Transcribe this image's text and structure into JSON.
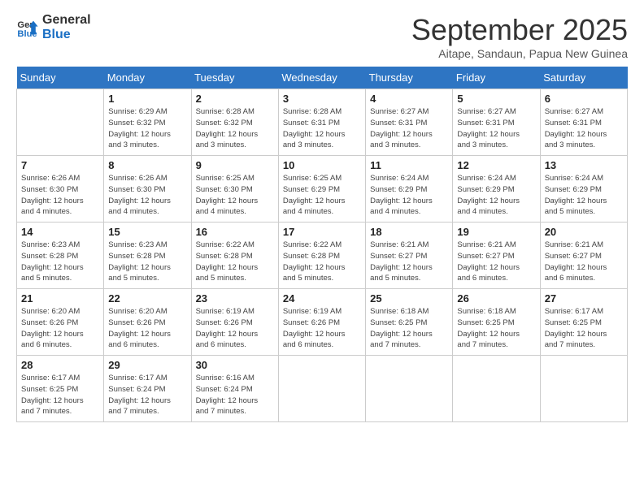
{
  "logo": {
    "line1": "General",
    "line2": "Blue"
  },
  "title": "September 2025",
  "subtitle": "Aitape, Sandaun, Papua New Guinea",
  "days_of_week": [
    "Sunday",
    "Monday",
    "Tuesday",
    "Wednesday",
    "Thursday",
    "Friday",
    "Saturday"
  ],
  "weeks": [
    [
      {
        "day": "",
        "info": ""
      },
      {
        "day": "1",
        "info": "Sunrise: 6:29 AM\nSunset: 6:32 PM\nDaylight: 12 hours\nand 3 minutes."
      },
      {
        "day": "2",
        "info": "Sunrise: 6:28 AM\nSunset: 6:32 PM\nDaylight: 12 hours\nand 3 minutes."
      },
      {
        "day": "3",
        "info": "Sunrise: 6:28 AM\nSunset: 6:31 PM\nDaylight: 12 hours\nand 3 minutes."
      },
      {
        "day": "4",
        "info": "Sunrise: 6:27 AM\nSunset: 6:31 PM\nDaylight: 12 hours\nand 3 minutes."
      },
      {
        "day": "5",
        "info": "Sunrise: 6:27 AM\nSunset: 6:31 PM\nDaylight: 12 hours\nand 3 minutes."
      },
      {
        "day": "6",
        "info": "Sunrise: 6:27 AM\nSunset: 6:31 PM\nDaylight: 12 hours\nand 3 minutes."
      }
    ],
    [
      {
        "day": "7",
        "info": "Sunrise: 6:26 AM\nSunset: 6:30 PM\nDaylight: 12 hours\nand 4 minutes."
      },
      {
        "day": "8",
        "info": "Sunrise: 6:26 AM\nSunset: 6:30 PM\nDaylight: 12 hours\nand 4 minutes."
      },
      {
        "day": "9",
        "info": "Sunrise: 6:25 AM\nSunset: 6:30 PM\nDaylight: 12 hours\nand 4 minutes."
      },
      {
        "day": "10",
        "info": "Sunrise: 6:25 AM\nSunset: 6:29 PM\nDaylight: 12 hours\nand 4 minutes."
      },
      {
        "day": "11",
        "info": "Sunrise: 6:24 AM\nSunset: 6:29 PM\nDaylight: 12 hours\nand 4 minutes."
      },
      {
        "day": "12",
        "info": "Sunrise: 6:24 AM\nSunset: 6:29 PM\nDaylight: 12 hours\nand 4 minutes."
      },
      {
        "day": "13",
        "info": "Sunrise: 6:24 AM\nSunset: 6:29 PM\nDaylight: 12 hours\nand 5 minutes."
      }
    ],
    [
      {
        "day": "14",
        "info": "Sunrise: 6:23 AM\nSunset: 6:28 PM\nDaylight: 12 hours\nand 5 minutes."
      },
      {
        "day": "15",
        "info": "Sunrise: 6:23 AM\nSunset: 6:28 PM\nDaylight: 12 hours\nand 5 minutes."
      },
      {
        "day": "16",
        "info": "Sunrise: 6:22 AM\nSunset: 6:28 PM\nDaylight: 12 hours\nand 5 minutes."
      },
      {
        "day": "17",
        "info": "Sunrise: 6:22 AM\nSunset: 6:28 PM\nDaylight: 12 hours\nand 5 minutes."
      },
      {
        "day": "18",
        "info": "Sunrise: 6:21 AM\nSunset: 6:27 PM\nDaylight: 12 hours\nand 5 minutes."
      },
      {
        "day": "19",
        "info": "Sunrise: 6:21 AM\nSunset: 6:27 PM\nDaylight: 12 hours\nand 6 minutes."
      },
      {
        "day": "20",
        "info": "Sunrise: 6:21 AM\nSunset: 6:27 PM\nDaylight: 12 hours\nand 6 minutes."
      }
    ],
    [
      {
        "day": "21",
        "info": "Sunrise: 6:20 AM\nSunset: 6:26 PM\nDaylight: 12 hours\nand 6 minutes."
      },
      {
        "day": "22",
        "info": "Sunrise: 6:20 AM\nSunset: 6:26 PM\nDaylight: 12 hours\nand 6 minutes."
      },
      {
        "day": "23",
        "info": "Sunrise: 6:19 AM\nSunset: 6:26 PM\nDaylight: 12 hours\nand 6 minutes."
      },
      {
        "day": "24",
        "info": "Sunrise: 6:19 AM\nSunset: 6:26 PM\nDaylight: 12 hours\nand 6 minutes."
      },
      {
        "day": "25",
        "info": "Sunrise: 6:18 AM\nSunset: 6:25 PM\nDaylight: 12 hours\nand 7 minutes."
      },
      {
        "day": "26",
        "info": "Sunrise: 6:18 AM\nSunset: 6:25 PM\nDaylight: 12 hours\nand 7 minutes."
      },
      {
        "day": "27",
        "info": "Sunrise: 6:17 AM\nSunset: 6:25 PM\nDaylight: 12 hours\nand 7 minutes."
      }
    ],
    [
      {
        "day": "28",
        "info": "Sunrise: 6:17 AM\nSunset: 6:25 PM\nDaylight: 12 hours\nand 7 minutes."
      },
      {
        "day": "29",
        "info": "Sunrise: 6:17 AM\nSunset: 6:24 PM\nDaylight: 12 hours\nand 7 minutes."
      },
      {
        "day": "30",
        "info": "Sunrise: 6:16 AM\nSunset: 6:24 PM\nDaylight: 12 hours\nand 7 minutes."
      },
      {
        "day": "",
        "info": ""
      },
      {
        "day": "",
        "info": ""
      },
      {
        "day": "",
        "info": ""
      },
      {
        "day": "",
        "info": ""
      }
    ]
  ]
}
